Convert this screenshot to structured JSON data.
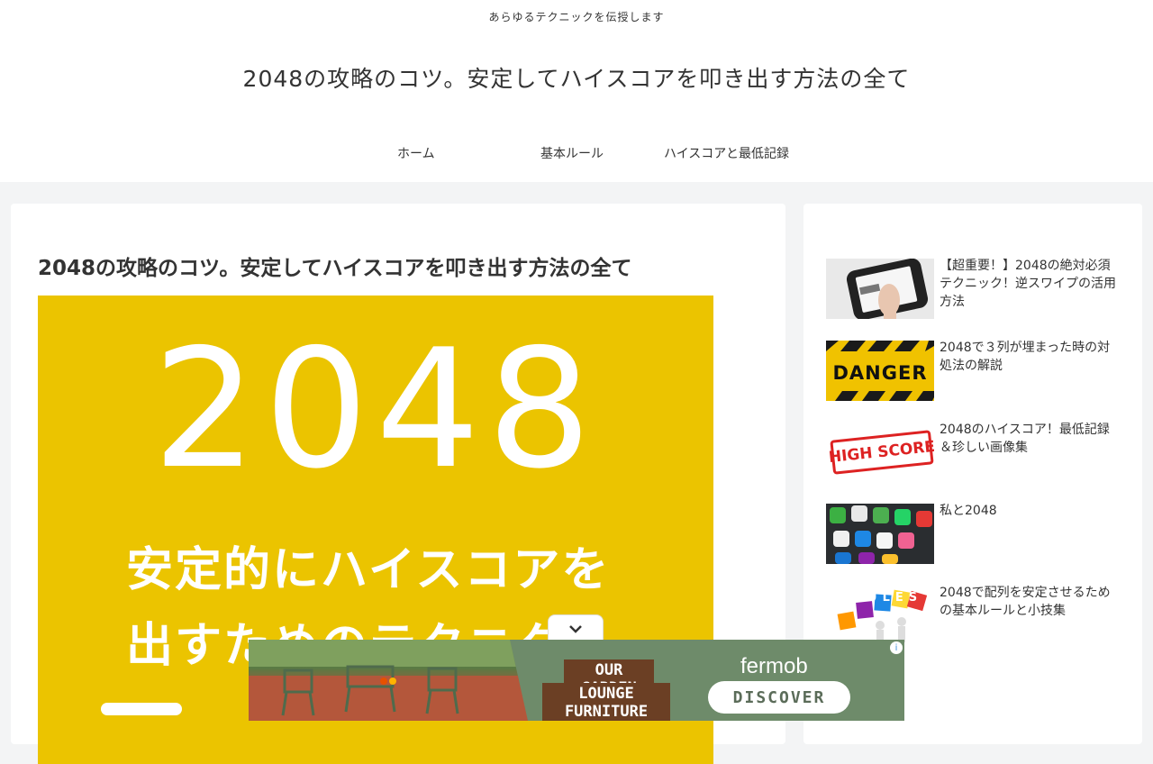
{
  "header": {
    "tagline": "あらゆるテクニックを伝授します",
    "site_title": "2048の攻略のコツ。安定してハイスコアを叩き出す方法の全て",
    "nav": {
      "home": "ホーム",
      "rules": "基本ルール",
      "high_score": "ハイスコアと最低記録"
    }
  },
  "article": {
    "title": "2048の攻略のコツ。安定してハイスコアを叩き出す方法の全て",
    "eyecatch": {
      "big_number": "2048",
      "line1": "安定的にハイスコアを",
      "line2": "出すためのテクニク",
      "background_color": "#ebc400"
    }
  },
  "sidebar": {
    "items": [
      {
        "title": "【超重要！】2048の絶対必須テクニック！逆スワイプの活用方法"
      },
      {
        "title": "2048で３列が埋まった時の対処法の解説",
        "thumb_text": "DANGER"
      },
      {
        "title": "2048のハイスコア！最低記録＆珍しい画像集",
        "thumb_text": "HIGH SCORE"
      },
      {
        "title": "私と2048"
      },
      {
        "title": "2048で配列を安定させるための基本ルールと小技集",
        "thumb_text": "RULES"
      }
    ]
  },
  "ad": {
    "headline1": "OUR GARDEN",
    "headline2": "LOUNGE FURNITURE",
    "brand": "fermob",
    "cta": "DISCOVER",
    "info": "i"
  }
}
